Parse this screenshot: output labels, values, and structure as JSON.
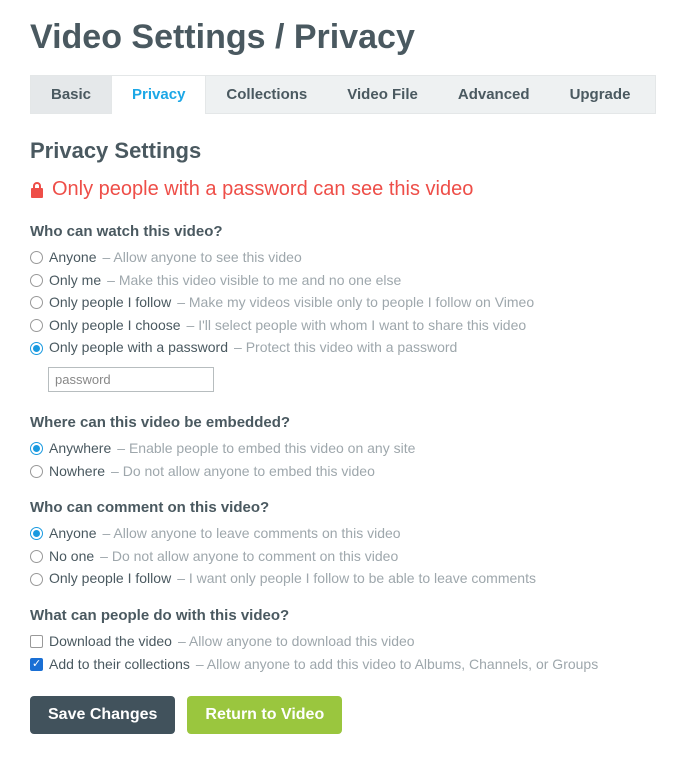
{
  "page_title": "Video Settings / Privacy",
  "tabs": [
    "Basic",
    "Privacy",
    "Collections",
    "Video File",
    "Advanced",
    "Upgrade"
  ],
  "active_tab_index": 1,
  "section_heading": "Privacy Settings",
  "status": {
    "icon": "lock-icon",
    "text": "Only people with a password can see this video",
    "color": "#ee4e48"
  },
  "watch": {
    "question": "Who can watch this video?",
    "options": [
      {
        "label": "Anyone",
        "desc": "Allow anyone to see this video",
        "checked": false
      },
      {
        "label": "Only me",
        "desc": "Make this video visible to me and no one else",
        "checked": false
      },
      {
        "label": "Only people I follow",
        "desc": "Make my videos visible only to people I follow on Vimeo",
        "checked": false
      },
      {
        "label": "Only people I choose",
        "desc": "I'll select people with whom I want to share this video",
        "checked": false
      },
      {
        "label": "Only people with a password",
        "desc": "Protect this video with a password",
        "checked": true
      }
    ],
    "password_value": "password"
  },
  "embed": {
    "question": "Where can this video be embedded?",
    "options": [
      {
        "label": "Anywhere",
        "desc": "Enable people to embed this video on any site",
        "checked": true
      },
      {
        "label": "Nowhere",
        "desc": "Do not allow anyone to embed this video",
        "checked": false
      }
    ]
  },
  "comment": {
    "question": "Who can comment on this video?",
    "options": [
      {
        "label": "Anyone",
        "desc": "Allow anyone to leave comments on this video",
        "checked": true
      },
      {
        "label": "No one",
        "desc": "Do not allow anyone to comment on this video",
        "checked": false
      },
      {
        "label": "Only people I follow",
        "desc": "I want only people I follow to be able to leave comments",
        "checked": false
      }
    ]
  },
  "actions": {
    "question": "What can people do with this video?",
    "options": [
      {
        "label": "Download the video",
        "desc": "Allow anyone to download this video",
        "checked": false
      },
      {
        "label": "Add to their collections",
        "desc": "Allow anyone to add this video to Albums, Channels, or Groups",
        "checked": true
      }
    ]
  },
  "buttons": {
    "save": "Save Changes",
    "return": "Return to Video"
  }
}
